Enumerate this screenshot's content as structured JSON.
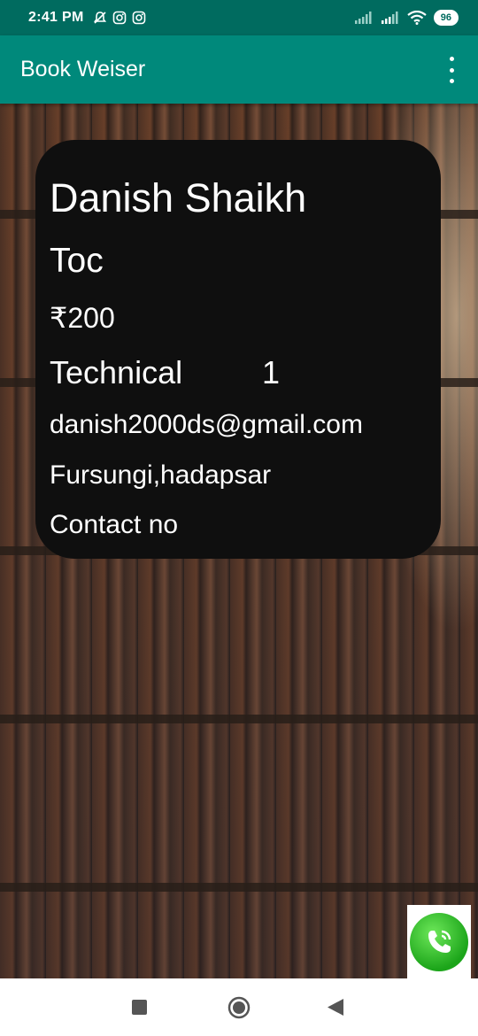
{
  "status_bar": {
    "time": "2:41 PM",
    "battery": "96"
  },
  "app_bar": {
    "title": "Book Weiser"
  },
  "book_details": {
    "seller_name": "Danish Shaikh",
    "book_title": "Toc",
    "price": "₹200",
    "category": "Technical",
    "quantity": "1",
    "email": "danish2000ds@gmail.com",
    "address": "Fursungi,hadapsar",
    "contact": "Contact no"
  },
  "icons": {
    "status_left": [
      "notifications-off-icon",
      "instagram-icon",
      "instagram-icon"
    ],
    "status_right": [
      "signal-icon",
      "signal-icon",
      "wifi-icon",
      "battery-icon"
    ],
    "overflow": "more-vert-icon",
    "call": "phone-icon",
    "nav": [
      "recents-square-icon",
      "home-circle-icon",
      "back-triangle-icon"
    ]
  },
  "colors": {
    "status_bar": "#006b5f",
    "app_bar": "#00897b",
    "card": "#0f0f0f",
    "call_button": "#2cc12a"
  }
}
